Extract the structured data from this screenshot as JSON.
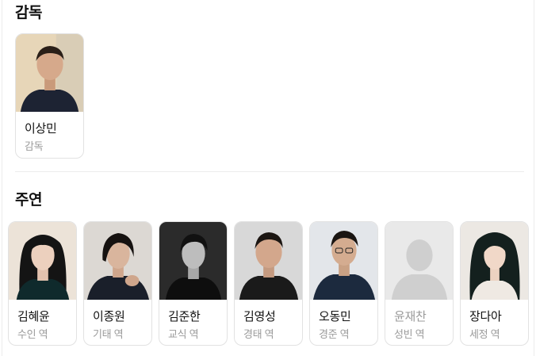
{
  "director": {
    "title": "감독",
    "people": [
      {
        "name": "이상민",
        "role": "감독"
      }
    ]
  },
  "cast": {
    "title": "주연",
    "people": [
      {
        "name": "김혜윤",
        "role": "수인 역"
      },
      {
        "name": "이종원",
        "role": "기태 역"
      },
      {
        "name": "김준한",
        "role": "교식 역"
      },
      {
        "name": "김영성",
        "role": "경태 역"
      },
      {
        "name": "오동민",
        "role": "경준 역"
      },
      {
        "name": "윤재찬",
        "role": "성빈 역"
      },
      {
        "name": "장다아",
        "role": "세정 역"
      }
    ]
  }
}
